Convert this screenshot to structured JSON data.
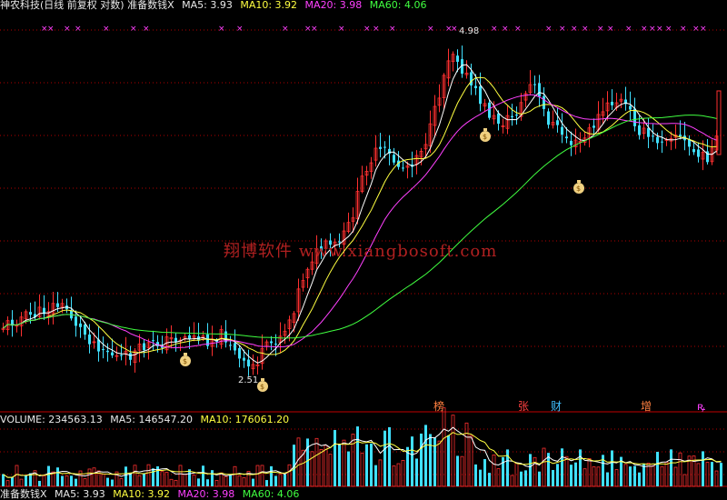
{
  "header": {
    "stock": "神农科技(日线 前复权 对数) 准备数钱X",
    "ma5": "MA5: 3.93",
    "ma10": "MA10: 3.92",
    "ma20": "MA20: 3.98",
    "ma60": "MA60: 4.06"
  },
  "volume_header": {
    "volume": "VOLUME: 234563.13",
    "ma5": "MA5: 146547.20",
    "ma10": "MA10: 176061.20"
  },
  "bottom_header": {
    "title": "准备数钱X",
    "ma5": "MA5: 3.93",
    "ma10": "MA10: 3.92",
    "ma20": "MA20: 3.98",
    "ma60": "MA60: 4.06"
  },
  "watermark": "翔博软件 www.xiangbosoft.com",
  "annotations": {
    "high": "4.98",
    "low": "2.51"
  },
  "signal_badges": [
    {
      "label": "榜",
      "color": "#ff8040"
    },
    {
      "label": "张",
      "color": "#ff4040"
    },
    {
      "label": "财",
      "color": "#40c0ff"
    },
    {
      "label": "增",
      "color": "#ff8040"
    },
    {
      "label": "ꝶ",
      "color": "#ff40ff"
    }
  ],
  "colors": {
    "background": "#000000",
    "up": "#ff3030",
    "down": "#40e0ff",
    "ma5": "#ffffff",
    "ma10": "#ffff40",
    "ma20": "#ff40ff",
    "ma60": "#40ff40",
    "grid": "#b00000"
  },
  "chart_data": {
    "type": "candlestick",
    "price_levels": [
      4.98,
      2.51
    ],
    "ma_latest": {
      "MA5": 3.93,
      "MA10": 3.92,
      "MA20": 3.98,
      "MA60": 4.06
    },
    "volume_latest": 234563.13,
    "volume_ma_latest": {
      "MA5": 146547.2,
      "MA10": 176061.2
    }
  }
}
